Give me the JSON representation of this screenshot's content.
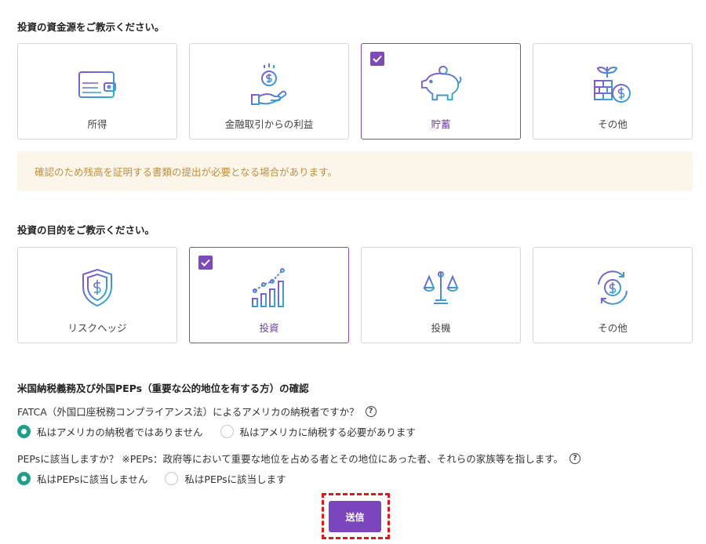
{
  "source_section": {
    "title": "投資の資金源をご教示ください。",
    "cards": [
      {
        "label": "所得",
        "icon": "wallet-icon",
        "selected": false
      },
      {
        "label": "金融取引からの利益",
        "icon": "coin-hand-icon",
        "selected": false
      },
      {
        "label": "貯蓄",
        "icon": "piggy-bank-icon",
        "selected": true
      },
      {
        "label": "その他",
        "icon": "plant-coins-icon",
        "selected": false
      }
    ],
    "notice": "確認のため残高を証明する書類の提出が必要となる場合があります。"
  },
  "purpose_section": {
    "title": "投資の目的をご教示ください。",
    "cards": [
      {
        "label": "リスクヘッジ",
        "icon": "shield-dollar-icon",
        "selected": false
      },
      {
        "label": "投資",
        "icon": "growth-chart-icon",
        "selected": true
      },
      {
        "label": "投機",
        "icon": "scale-icon",
        "selected": false
      },
      {
        "label": "その他",
        "icon": "cycle-dollar-icon",
        "selected": false
      }
    ]
  },
  "confirm_section": {
    "title": "米国納税義務及び外国PEPs（重要な公的地位を有する方）の確認",
    "fatca": {
      "question": "FATCA（外国口座税務コンプライアンス法）によるアメリカの納税者ですか？",
      "options": [
        "私はアメリカの納税者ではありません",
        "私はアメリカに納税する必要があります"
      ],
      "selected_index": 0
    },
    "peps": {
      "question": "PEPsに該当しますか？ ※PEPs：政府等において重要な地位を占める者とその地位にあった者、それらの家族等を指します。",
      "options": [
        "私はPEPsに該当しません",
        "私はPEPsに該当します"
      ],
      "selected_index": 0
    },
    "help_glyph": "?"
  },
  "submit_label": "送信",
  "colors": {
    "accent_purple": "#7c4bb8",
    "radio_teal": "#1f9e8a",
    "notice_bg": "#fbf5ea",
    "notice_text": "#c09040",
    "highlight_red": "#e01818"
  }
}
